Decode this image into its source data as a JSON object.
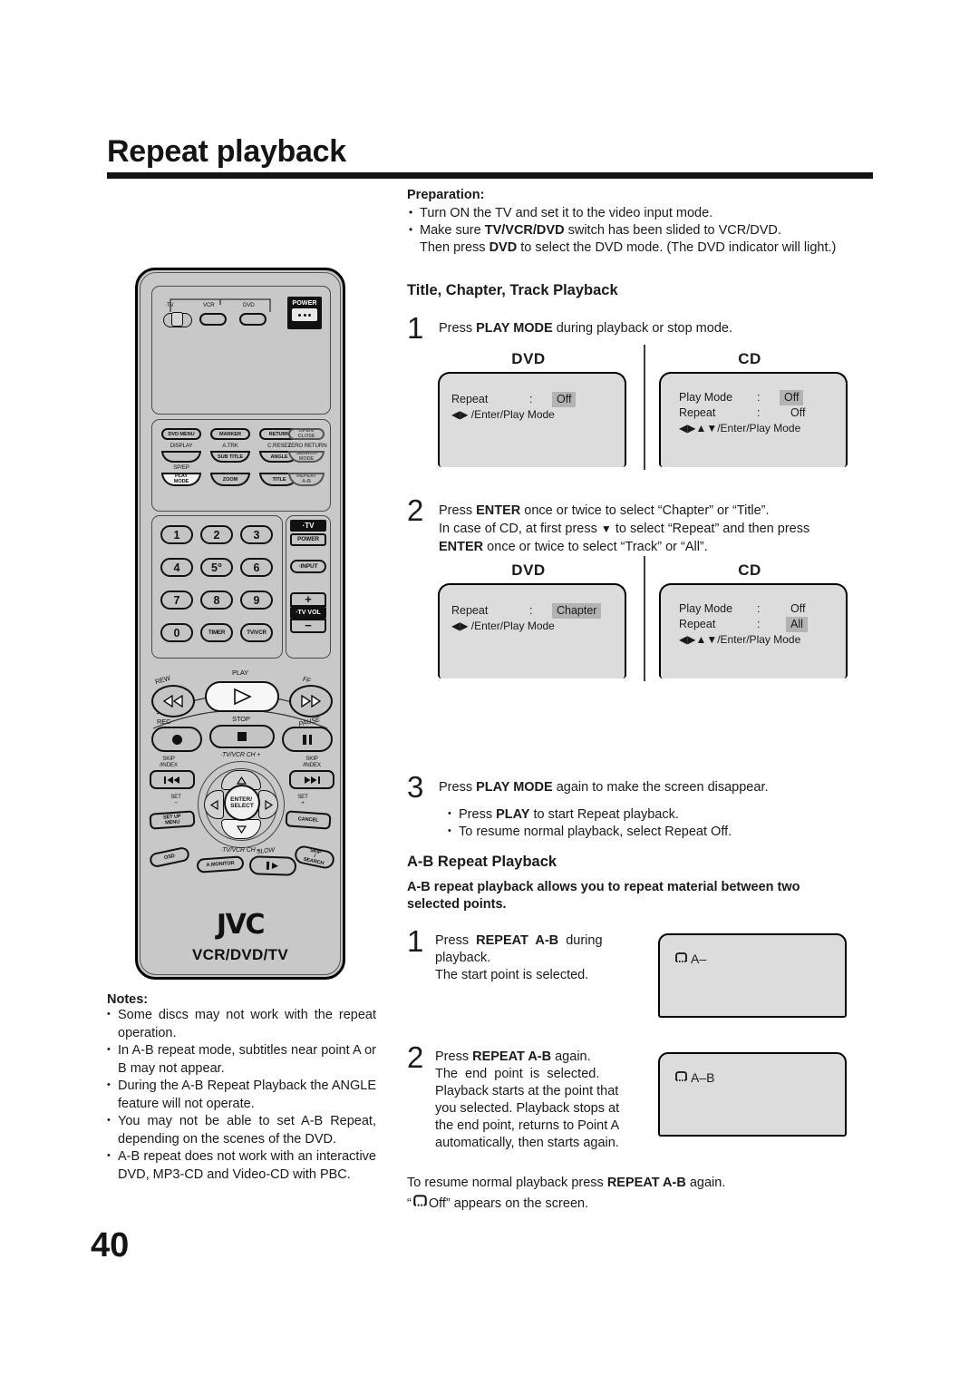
{
  "page": {
    "title": "Repeat playback",
    "number": "40"
  },
  "preparation": {
    "heading": "Preparation:",
    "bullets": [
      {
        "text": "Turn ON the TV and set it to the video input mode."
      },
      {
        "text": "Make sure TV/VCR/DVD switch has been slided to VCR/DVD.",
        "cont": "Then press DVD to select the DVD mode. (The DVD indicator will light.)"
      }
    ]
  },
  "section_title_chapter_track": {
    "heading": "Title, Chapter, Track Playback",
    "steps": [
      {
        "num": "1",
        "line1": "Press PLAY MODE during playback or stop mode."
      },
      {
        "num": "2",
        "line1": "Press ENTER once or twice to select “Chapter” or “Title”.",
        "line2": "In case of CD, at first press ▼ to select “Repeat” and then press",
        "line3": "ENTER once or twice to select “Track” or “All”."
      },
      {
        "num": "3",
        "line1": "Press PLAY MODE again to make the screen disappear.",
        "bullets": [
          "Press PLAY to start Repeat playback.",
          "To resume normal playback, select Repeat Off."
        ]
      }
    ]
  },
  "osd_step1": {
    "dvd": {
      "label": "DVD",
      "rows": [
        {
          "name": "Repeat",
          "colon": ":",
          "value": "Off",
          "highlight": true
        }
      ],
      "keys": "◀▶ /Enter/Play Mode"
    },
    "cd": {
      "label": "CD",
      "rows": [
        {
          "name": "Play Mode",
          "colon": ":",
          "value": "Off",
          "highlight": true
        },
        {
          "name": "Repeat",
          "colon": ":",
          "value": "Off",
          "highlight": false
        }
      ],
      "keys": "◀▶▲▼/Enter/Play Mode"
    }
  },
  "osd_step2": {
    "dvd": {
      "label": "DVD",
      "rows": [
        {
          "name": "Repeat",
          "colon": ":",
          "value": "Chapter",
          "highlight": true
        }
      ],
      "keys": "◀▶ /Enter/Play Mode"
    },
    "cd": {
      "label": "CD",
      "rows": [
        {
          "name": "Play Mode",
          "colon": ":",
          "value": "Off",
          "highlight": false
        },
        {
          "name": "Repeat",
          "colon": ":",
          "value": "All",
          "highlight": true
        }
      ],
      "keys": "◀▶▲▼/Enter/Play Mode"
    }
  },
  "section_ab_repeat": {
    "heading": "A-B Repeat Playback",
    "intro_line1": "A-B repeat playback allows you to repeat material between two",
    "intro_line2": "selected points.",
    "steps": [
      {
        "num": "1",
        "line1": "Press REPEAT A-B during",
        "line2": "playback.",
        "line3": "The start point is selected.",
        "osd_text": "A–"
      },
      {
        "num": "2",
        "line1": "Press REPEAT A-B again.",
        "line2": "The end point is selected.",
        "line3": "Playback starts at the point that",
        "line4": "you selected. Playback stops at",
        "line5": "the end point, returns to Point A",
        "line6": "automatically, then starts again.",
        "osd_text": "A–B"
      }
    ],
    "footer_line1": "To resume normal playback press REPEAT A-B again.",
    "footer_line2_pre": "“",
    "footer_line2_post": " Off” appears on the screen."
  },
  "notes": {
    "heading": "Notes:",
    "items": [
      "Some discs may not work with the repeat operation.",
      "In A-B repeat mode, subtitles near point A or B may not appear.",
      "During the A-B Repeat Playback the ANGLE feature will not operate.",
      "You may not be able to set A-B Repeat, depending on the scenes of the DVD.",
      "A-B repeat does not work with an interactive DVD, MP3-CD and Video-CD with PBC."
    ]
  },
  "remote": {
    "brand": "JVC",
    "model": "VCR/DVD/TV",
    "source_switch": {
      "tv": "TV",
      "vcr": "VCR",
      "dvd": "DVD"
    },
    "power": {
      "label": "POWER",
      "dots": "●●●"
    },
    "row_a": [
      "DVD MENU",
      "MARKER",
      "RETURN",
      "OPEN/\nCLOSE"
    ],
    "row_b_labels": [
      "DISPLAY",
      "A.TRK",
      "C.RESET",
      "ZERO RETURN"
    ],
    "row_b": [
      "",
      "SUB TITLE",
      "ANGLE",
      "SEARCH\nMODE"
    ],
    "row_c_labels": [
      "SP/EP",
      "",
      "",
      ""
    ],
    "row_c": [
      "PLAY\nMODE",
      "ZOOM",
      "TITLE",
      "REPEAT\nA-B"
    ],
    "keypad": [
      "1",
      "2",
      "3",
      "4",
      "5°",
      "6",
      "7",
      "8",
      "9",
      "0",
      "TIMER",
      "TV/VCR"
    ],
    "tv_block": {
      "title": "·TV",
      "power": "POWER",
      "input": "·INPUT",
      "vol_up": "+",
      "vol_label": "·TV VOL",
      "vol_down": "−"
    },
    "transport": {
      "rew": "REW",
      "play": "PLAY",
      "ff": "FF",
      "rec": "REC",
      "stop": "STOP",
      "pause": "PAUSE",
      "skip_index_left": "SKIP\n/INDEX",
      "skip_index_right": "SKIP\n/INDEX",
      "ch_up": "·TV/VCR CH +",
      "ch_down": "·TV/VCR CH –",
      "set_minus": "SET\n–",
      "set_plus": "SET\n+",
      "enter": "ENTER/\nSELECT",
      "setup_menu": "SET UP\nMENU",
      "cancel": "CANCEL",
      "osd": "OSD",
      "a_monitor": "A.MONITOR",
      "slow": "SLOW",
      "skip_search": "SKIP\n/\nSEARCH"
    }
  }
}
